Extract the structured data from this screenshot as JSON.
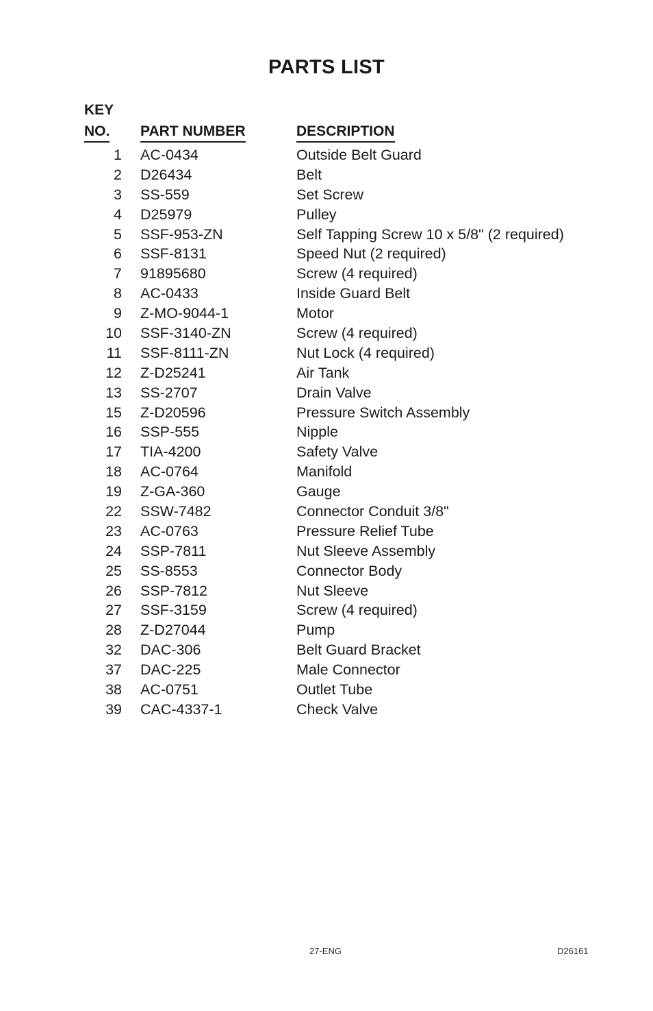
{
  "document": {
    "title": "PARTS LIST"
  },
  "table": {
    "headers": {
      "key_line1": "KEY",
      "key_line2": "NO.",
      "part_number": "PART NUMBER",
      "description": "DESCRIPTION"
    },
    "rows": [
      {
        "key": "1",
        "part_number": "AC-0434",
        "description": "Outside Belt Guard"
      },
      {
        "key": "2",
        "part_number": "D26434",
        "description": "Belt"
      },
      {
        "key": "3",
        "part_number": "SS-559",
        "description": "Set Screw"
      },
      {
        "key": "4",
        "part_number": "D25979",
        "description": "Pulley"
      },
      {
        "key": "5",
        "part_number": "SSF-953-ZN",
        "description": "Self Tapping Screw 10 x 5/8\" (2 required)"
      },
      {
        "key": "6",
        "part_number": "SSF-8131",
        "description": "Speed Nut (2 required)"
      },
      {
        "key": "7",
        "part_number": "91895680",
        "description": "Screw (4 required)"
      },
      {
        "key": "8",
        "part_number": "AC-0433",
        "description": "Inside Guard Belt"
      },
      {
        "key": "9",
        "part_number": "Z-MO-9044-1",
        "description": "Motor"
      },
      {
        "key": "10",
        "part_number": "SSF-3140-ZN",
        "description": "Screw (4 required)"
      },
      {
        "key": "11",
        "part_number": "SSF-8111-ZN",
        "description": "Nut Lock (4 required)"
      },
      {
        "key": "12",
        "part_number": "Z-D25241",
        "description": "Air Tank"
      },
      {
        "key": "13",
        "part_number": "SS-2707",
        "description": "Drain Valve"
      },
      {
        "key": "15",
        "part_number": "Z-D20596",
        "description": "Pressure Switch Assembly"
      },
      {
        "key": "16",
        "part_number": "SSP-555",
        "description": "Nipple"
      },
      {
        "key": "17",
        "part_number": "TIA-4200",
        "description": "Safety Valve"
      },
      {
        "key": "18",
        "part_number": "AC-0764",
        "description": "Manifold"
      },
      {
        "key": "19",
        "part_number": "Z-GA-360",
        "description": "Gauge"
      },
      {
        "key": "22",
        "part_number": "SSW-7482",
        "description": "Connector Conduit 3/8\""
      },
      {
        "key": "23",
        "part_number": "AC-0763",
        "description": "Pressure Relief Tube"
      },
      {
        "key": "24",
        "part_number": "SSP-7811",
        "description": "Nut Sleeve Assembly"
      },
      {
        "key": "25",
        "part_number": "SS-8553",
        "description": "Connector Body"
      },
      {
        "key": "26",
        "part_number": "SSP-7812",
        "description": "Nut Sleeve"
      },
      {
        "key": "27",
        "part_number": "SSF-3159",
        "description": "Screw (4 required)"
      },
      {
        "key": "28",
        "part_number": "Z-D27044",
        "description": "Pump"
      },
      {
        "key": "32",
        "part_number": "DAC-306",
        "description": "Belt Guard Bracket"
      },
      {
        "key": "37",
        "part_number": "DAC-225",
        "description": "Male Connector"
      },
      {
        "key": "38",
        "part_number": "AC-0751",
        "description": "Outlet Tube"
      },
      {
        "key": "39",
        "part_number": "CAC-4337-1",
        "description": "Check Valve"
      }
    ]
  },
  "footer": {
    "page_label": "27-ENG",
    "document_number": "D26161"
  }
}
